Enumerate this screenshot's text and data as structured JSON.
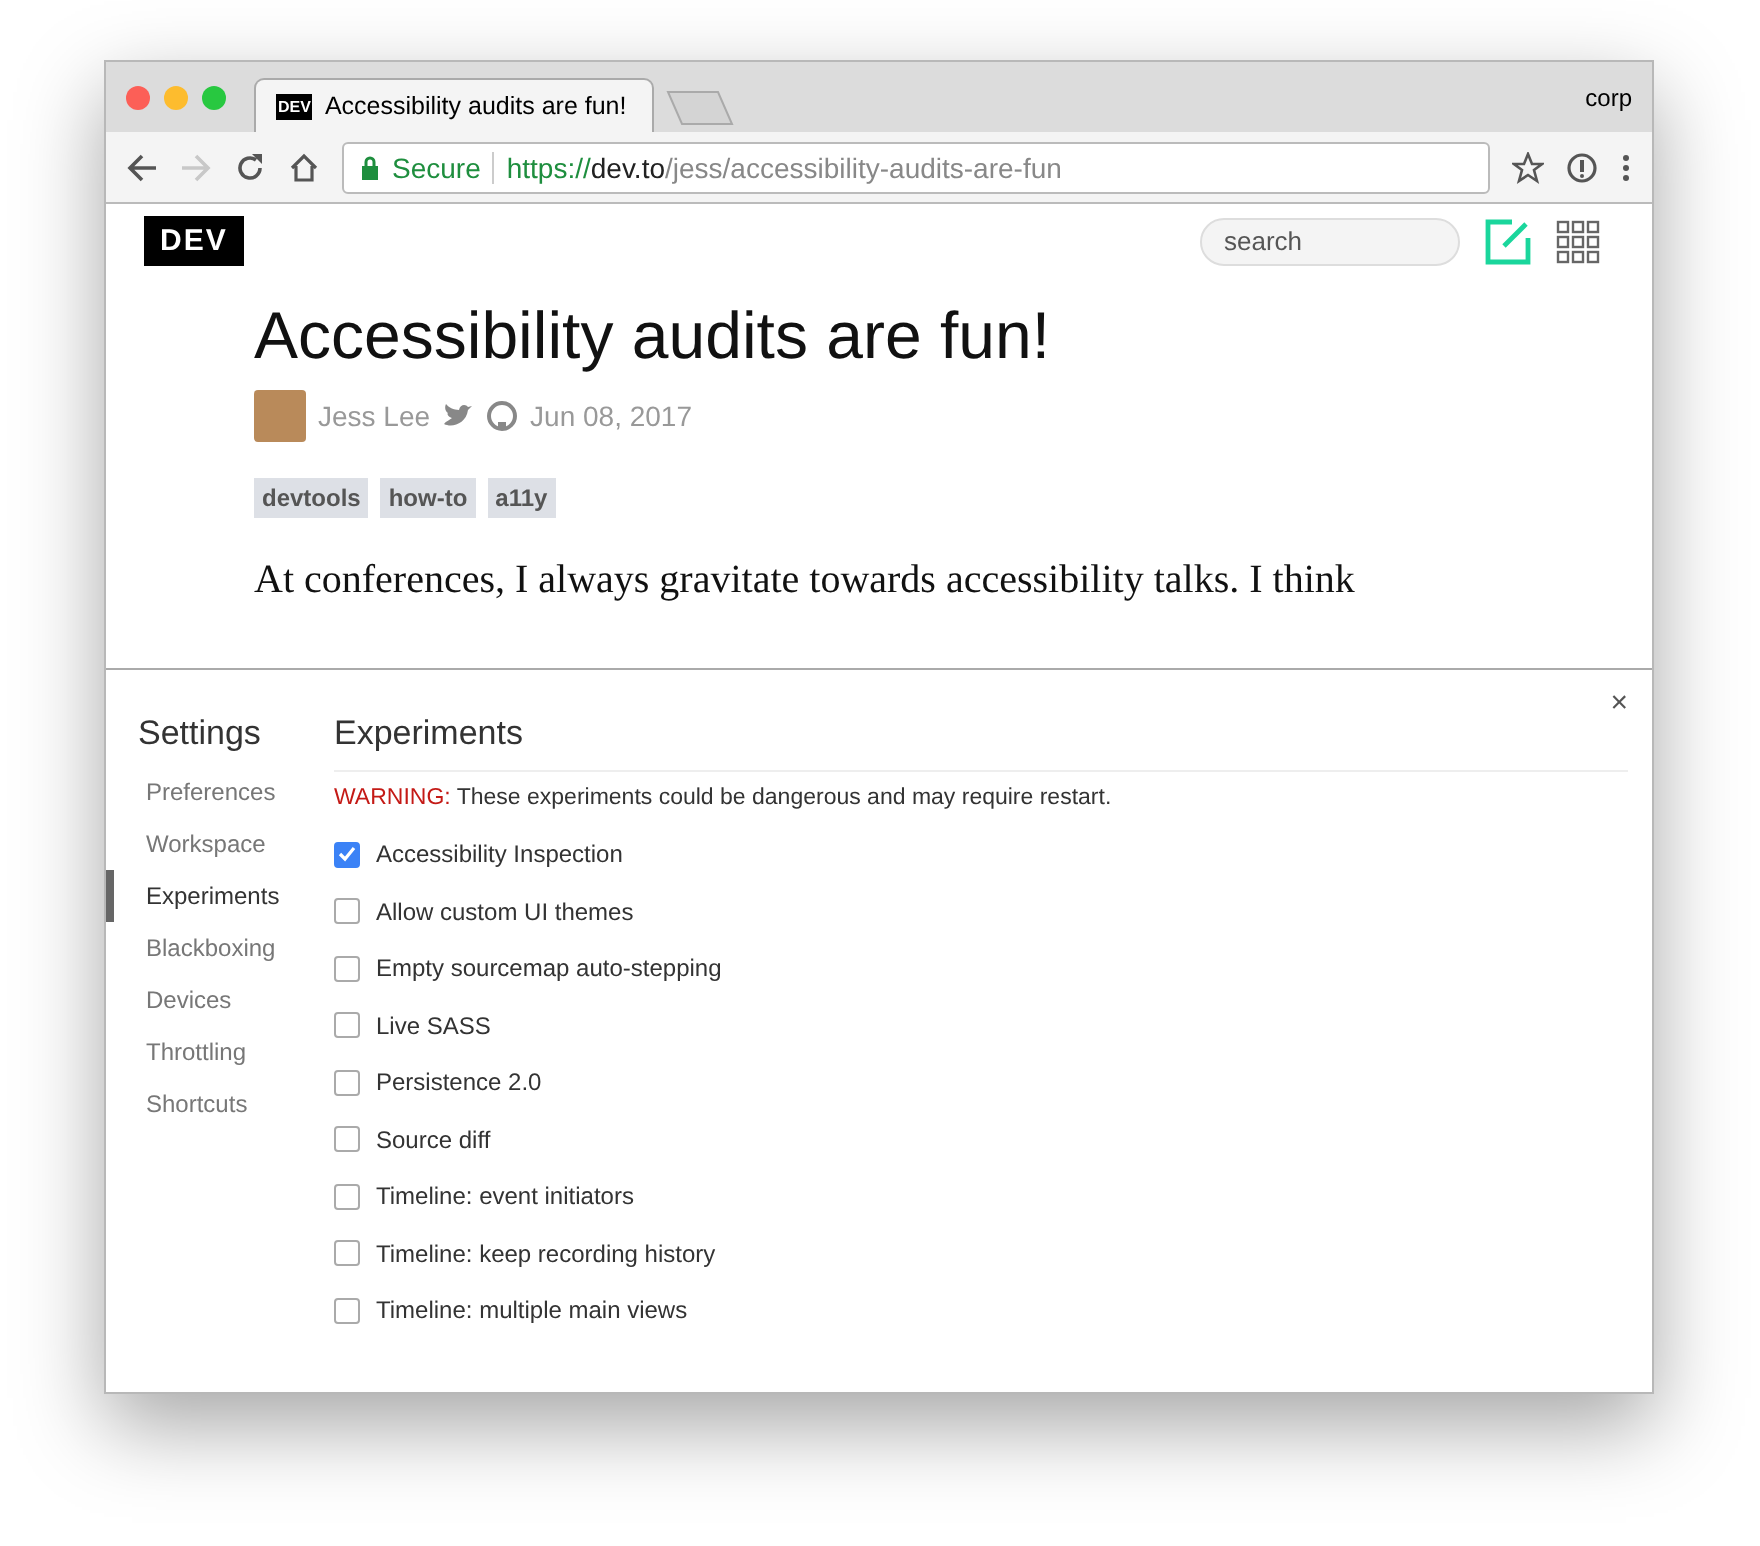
{
  "window": {
    "profile": "corp"
  },
  "tabs": [
    {
      "title": "Accessibility audits are fun!",
      "favicon": "DEV",
      "selected": true
    }
  ],
  "address_bar": {
    "security": "Secure",
    "scheme": "https://",
    "host": "dev.to",
    "path": "/jess/accessibility-audits-are-fun"
  },
  "page": {
    "logo": "DEV",
    "search": {
      "placeholder": "search"
    },
    "title": "Accessibility audits are fun!",
    "author": "Jess Lee",
    "date": "Jun 08, 2017",
    "tags": [
      "devtools",
      "how-to",
      "a11y"
    ],
    "paragraph": "At conferences, I always gravitate towards accessibility talks. I think"
  },
  "settings": {
    "title": "Settings",
    "sidebar": [
      {
        "label": "Preferences",
        "selected": false
      },
      {
        "label": "Workspace",
        "selected": false
      },
      {
        "label": "Experiments",
        "selected": true
      },
      {
        "label": "Blackboxing",
        "selected": false
      },
      {
        "label": "Devices",
        "selected": false
      },
      {
        "label": "Throttling",
        "selected": false
      },
      {
        "label": "Shortcuts",
        "selected": false
      }
    ],
    "heading": "Experiments",
    "close": "×",
    "warning": {
      "label": "WARNING:",
      "text": "These experiments could be dangerous and may require restart."
    },
    "experiments": [
      {
        "label": "Accessibility Inspection",
        "checked": true
      },
      {
        "label": "Allow custom UI themes",
        "checked": false
      },
      {
        "label": "Empty sourcemap auto-stepping",
        "checked": false
      },
      {
        "label": "Live SASS",
        "checked": false
      },
      {
        "label": "Persistence 2.0",
        "checked": false
      },
      {
        "label": "Source diff",
        "checked": false
      },
      {
        "label": "Timeline: event initiators",
        "checked": false
      },
      {
        "label": "Timeline: keep recording history",
        "checked": false
      },
      {
        "label": "Timeline: multiple main views",
        "checked": false
      }
    ]
  }
}
